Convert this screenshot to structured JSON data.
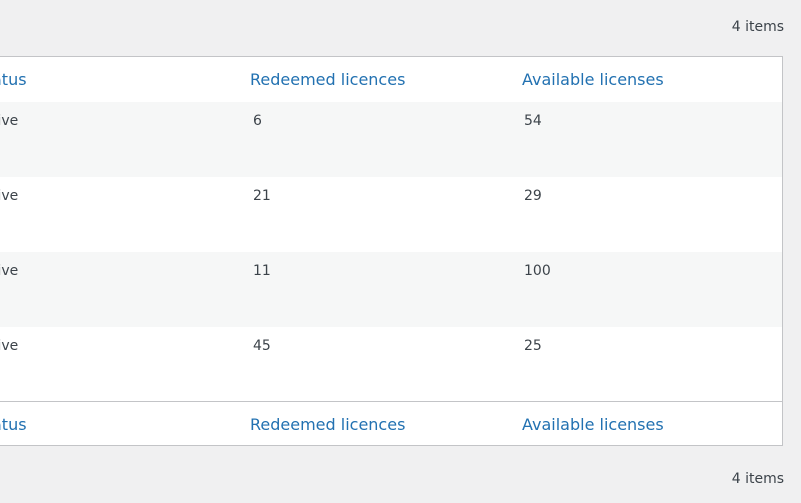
{
  "pagination": {
    "top_count": "4 items",
    "bottom_count": "4 items"
  },
  "table": {
    "columns": [
      "atus",
      "Redeemed licences",
      "Available licenses"
    ],
    "rows": [
      {
        "status": "tive",
        "redeemed": "6",
        "available": "54"
      },
      {
        "status": "tive",
        "redeemed": "21",
        "available": "29"
      },
      {
        "status": "tive",
        "redeemed": "11",
        "available": "100"
      },
      {
        "status": "tive",
        "redeemed": "45",
        "available": "25"
      }
    ],
    "footer_columns": [
      "atus",
      "Redeemed licences",
      "Available licenses"
    ]
  },
  "colors": {
    "link": "#2271b1",
    "text": "#3c434a",
    "border": "#c3c4c7",
    "stripe": "#f6f7f7",
    "background": "#f0f0f1"
  }
}
